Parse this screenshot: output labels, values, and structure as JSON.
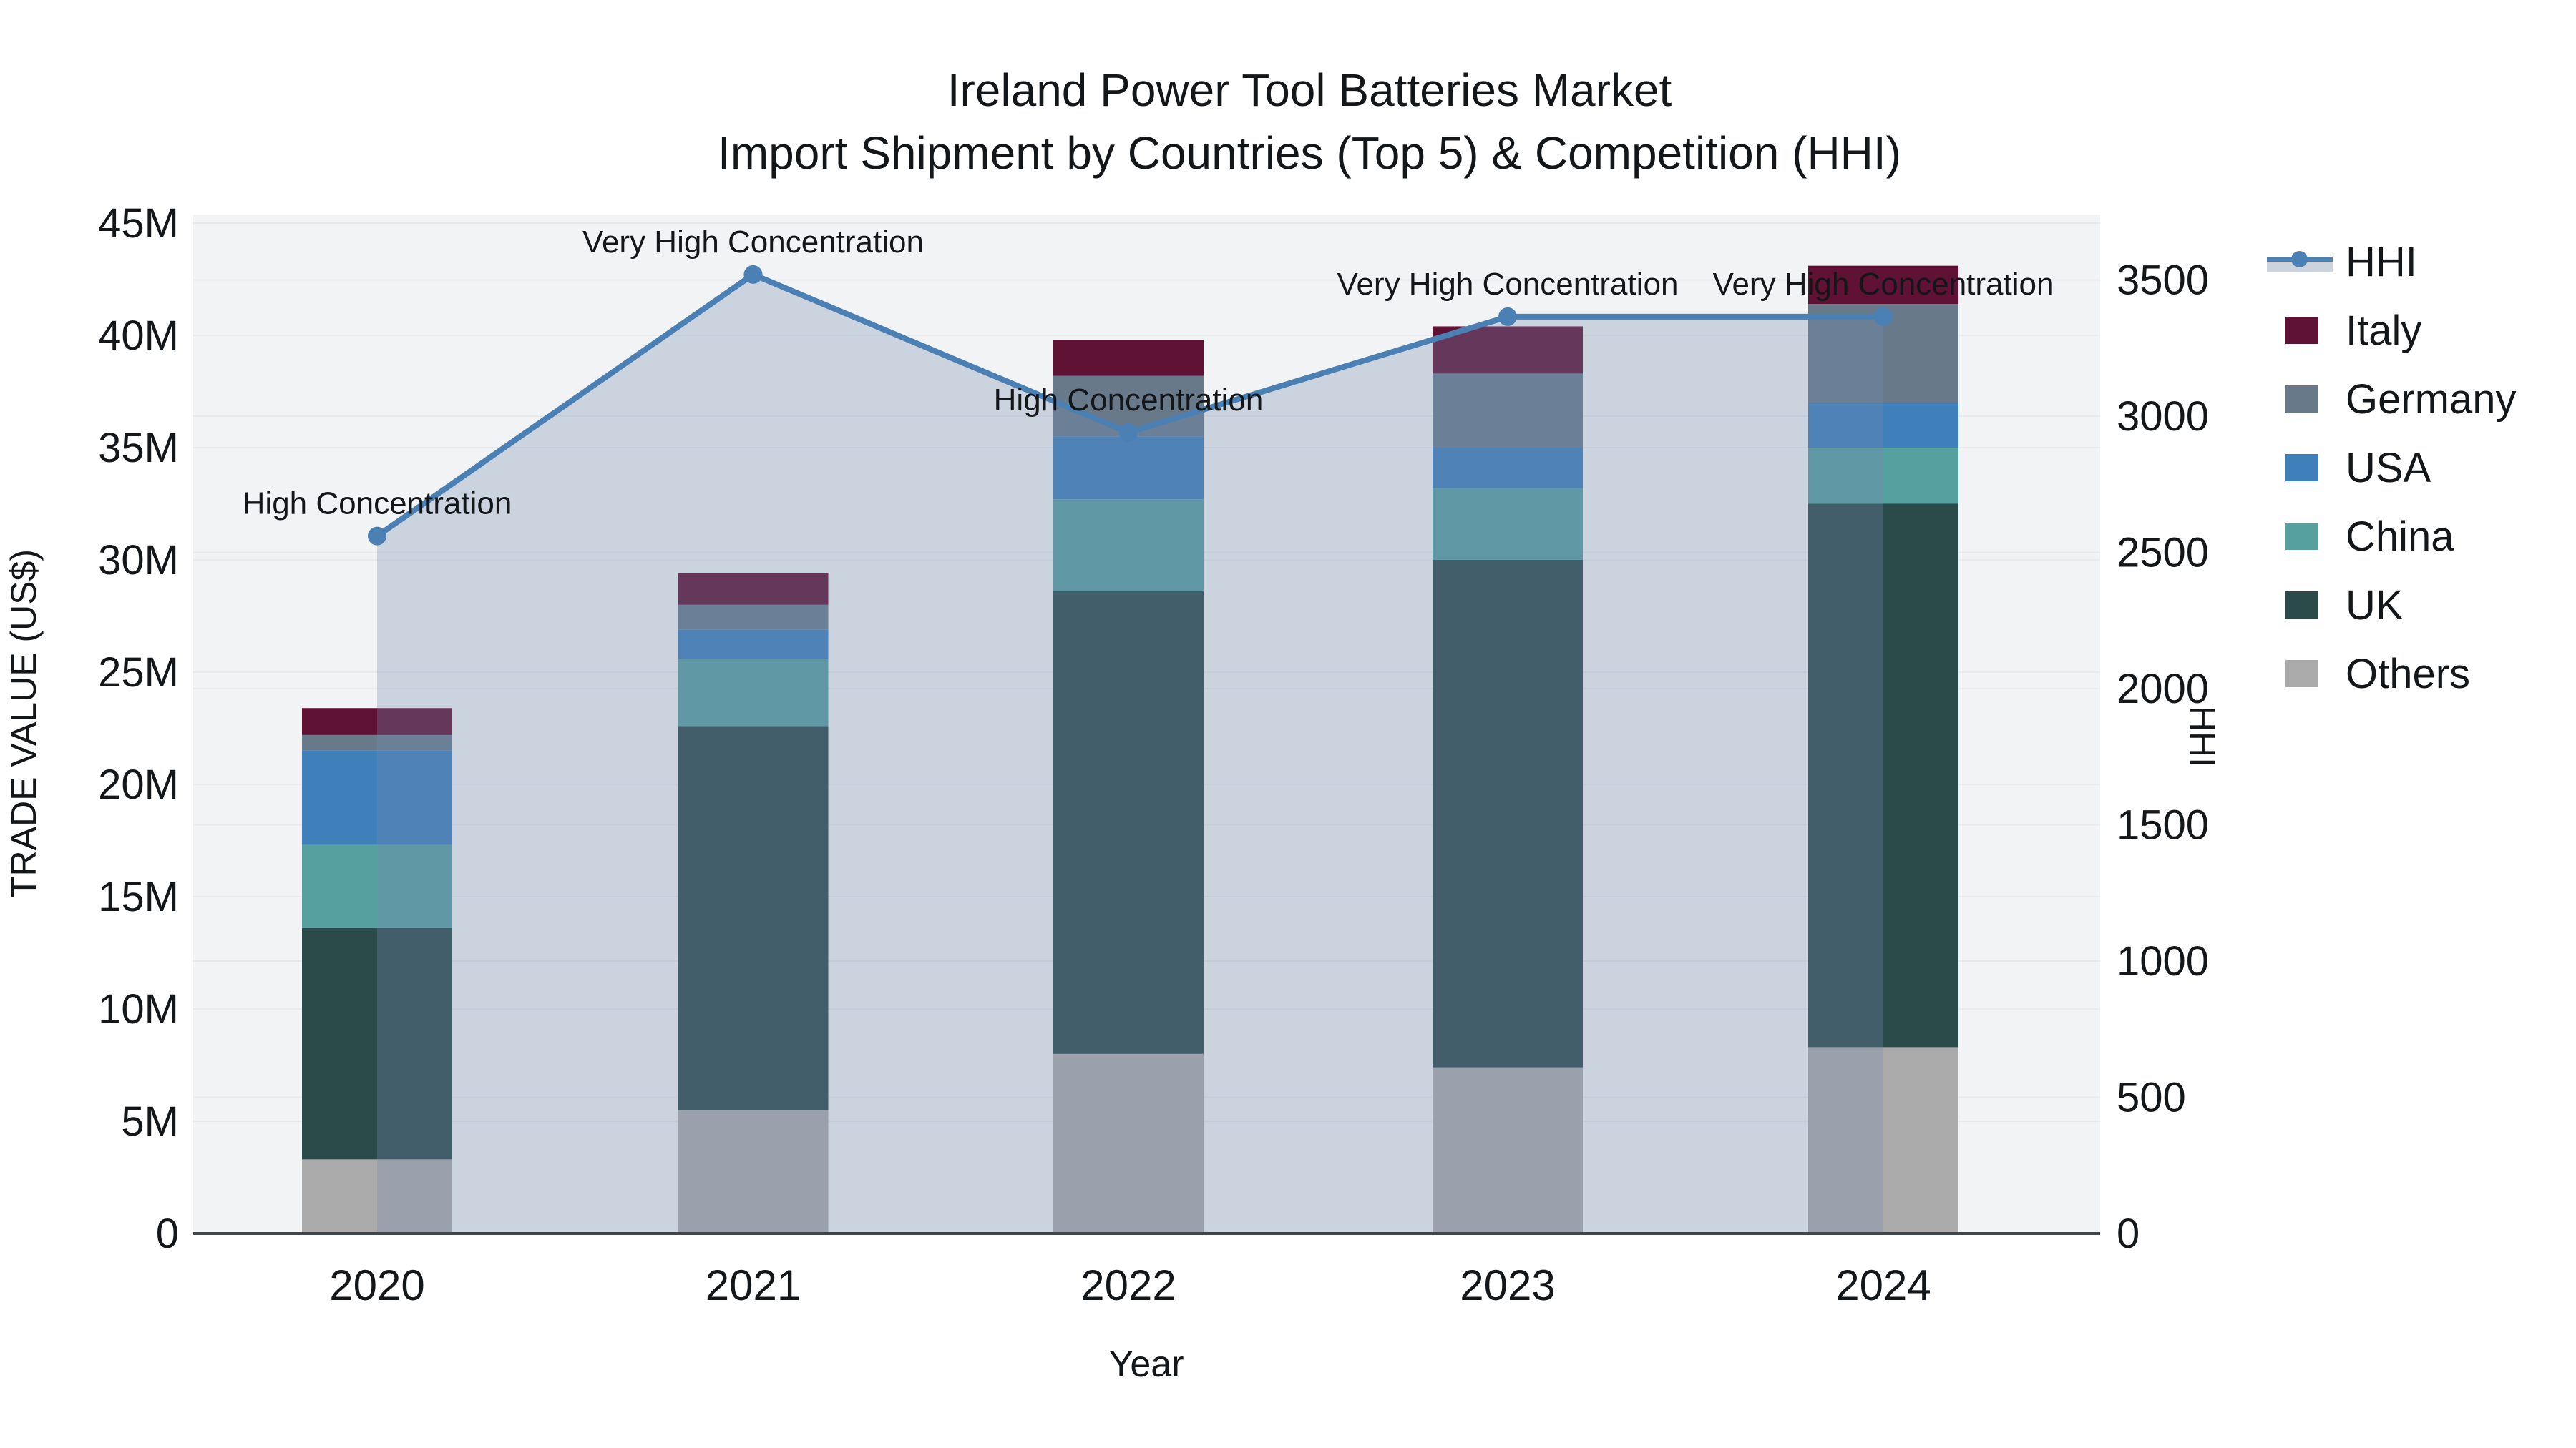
{
  "chart_data": {
    "type": "bar",
    "subtype": "stacked-bar-with-line",
    "title": "Ireland Power Tool Batteries Market",
    "subtitle": "Import Shipment by Countries (Top 5) & Competition (HHI)",
    "xlabel": "Year",
    "ylabel_left": "TRADE VALUE (US$)",
    "ylabel_right": "HHI",
    "categories": [
      "2020",
      "2021",
      "2022",
      "2023",
      "2024"
    ],
    "value_unit": "M",
    "series": [
      {
        "name": "Others",
        "color": "#ababab",
        "values": [
          3.3,
          5.5,
          8.0,
          7.4,
          8.3
        ]
      },
      {
        "name": "UK",
        "color": "#2b4a4a",
        "values": [
          10.3,
          17.1,
          20.6,
          22.6,
          24.2
        ]
      },
      {
        "name": "China",
        "color": "#57a0a0",
        "values": [
          3.7,
          3.0,
          4.1,
          3.2,
          2.5
        ]
      },
      {
        "name": "USA",
        "color": "#3f7fba",
        "values": [
          4.2,
          1.3,
          2.8,
          1.8,
          2.0
        ]
      },
      {
        "name": "Germany",
        "color": "#687a8a",
        "values": [
          0.7,
          1.1,
          2.7,
          3.3,
          4.4
        ]
      },
      {
        "name": "Italy",
        "color": "#5f1233",
        "values": [
          1.2,
          1.4,
          1.6,
          2.1,
          1.7
        ]
      }
    ],
    "bar_totals": [
      23.4,
      29.4,
      39.8,
      40.4,
      43.1
    ],
    "hhi": {
      "name": "HHI",
      "line_color": "#4b80b4",
      "area_fill": "rgba(116,139,177,0.31)",
      "values": [
        2560,
        3520,
        2940,
        3365,
        3365
      ]
    },
    "annotations": [
      "High Concentration",
      "Very High Concentration",
      "High Concentration",
      "Very High Concentration",
      "Very High Concentration"
    ],
    "y_left": {
      "tick_labels": [
        "0",
        "5M",
        "10M",
        "15M",
        "20M",
        "25M",
        "30M",
        "35M",
        "40M",
        "45M"
      ],
      "tick_values": [
        0,
        5,
        10,
        15,
        20,
        25,
        30,
        35,
        40,
        45
      ],
      "range": [
        0,
        45.4
      ]
    },
    "y_right": {
      "tick_labels": [
        "0",
        "500",
        "1000",
        "1500",
        "2000",
        "2500",
        "3000",
        "3500"
      ],
      "tick_values": [
        0,
        500,
        1000,
        1500,
        2000,
        2500,
        3000,
        3500
      ],
      "range": [
        0,
        3740
      ]
    },
    "legend_entries": [
      "HHI",
      "Italy",
      "Germany",
      "USA",
      "China",
      "UK",
      "Others"
    ],
    "legend_position": "right",
    "grid": true,
    "colors": {
      "plot_bg": "#f2f3f4",
      "gridline": "#e9eaec",
      "axis_line": "#42474c",
      "text": "#14171a"
    }
  }
}
